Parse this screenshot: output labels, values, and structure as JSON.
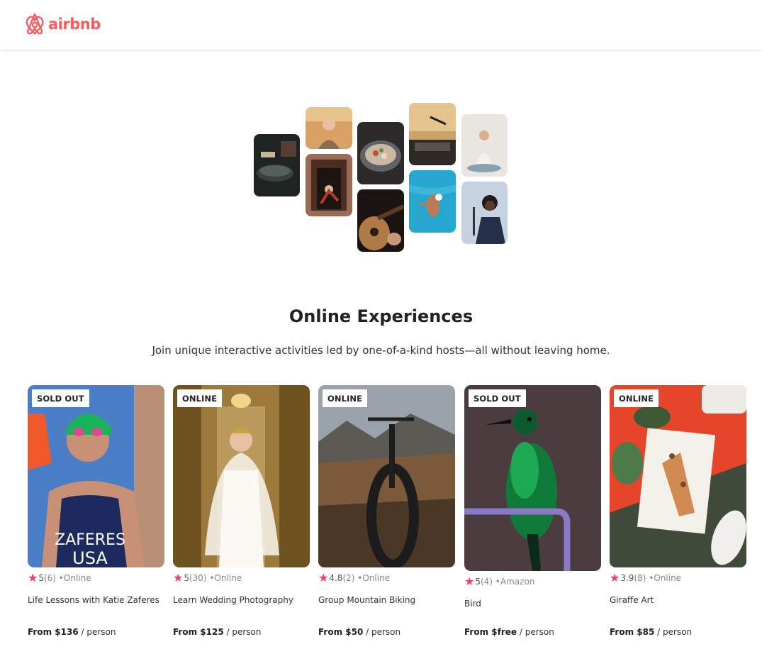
{
  "header": {
    "logo_text": "airbnb",
    "logo_icon": "airbnb-logo-icon",
    "brand_color": "#ff5a5f"
  },
  "hero": {
    "photos": [
      "cooking",
      "portrait-woman",
      "doorway-dancer",
      "food-bowl",
      "guitar",
      "dj-turntable",
      "swimmer",
      "yoga",
      "singer"
    ]
  },
  "main": {
    "title": "Online Experiences",
    "subtitle": "Join unique interactive activities led by one-of-a-kind hosts—all without leaving home."
  },
  "cards": [
    {
      "badge": "SOLD OUT",
      "rating": "5",
      "count": "(6)",
      "location": "Online",
      "title": "Life Lessons with Katie Zaferes",
      "price": "From $136",
      "unit": "person"
    },
    {
      "badge": "ONLINE",
      "rating": "5",
      "count": "(30)",
      "location": "Online",
      "title": "Learn Wedding Photography",
      "price": "From $125",
      "unit": "person"
    },
    {
      "badge": "ONLINE",
      "rating": "4.8",
      "count": "(2)",
      "location": "Online",
      "title": "Group Mountain Biking",
      "price": "From $50",
      "unit": "person"
    },
    {
      "badge": "SOLD OUT",
      "rating": "5",
      "count": "(4)",
      "location": "Amazon",
      "title": "Bird",
      "price": "From $free",
      "unit": "person"
    },
    {
      "badge": "ONLINE",
      "rating": "3.9",
      "count": "(8)",
      "location": "Online",
      "title": "Giraffe Art",
      "price": "From $85",
      "unit": "person"
    }
  ],
  "colors": {
    "star": "#ff385c",
    "text": "#222222",
    "muted": "#888888"
  }
}
